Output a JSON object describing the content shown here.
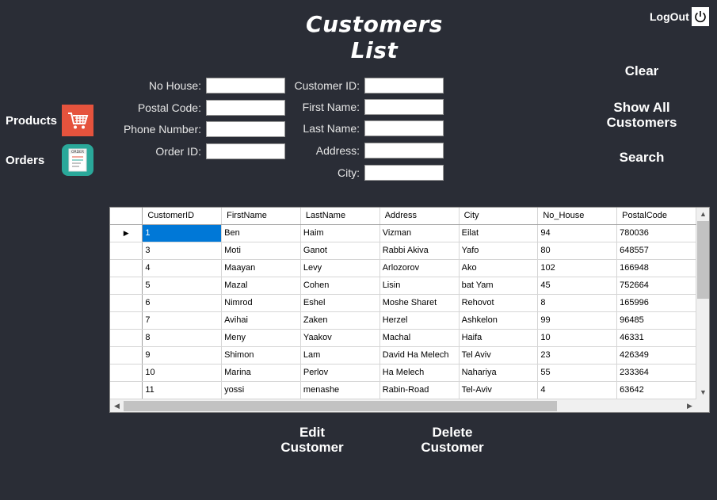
{
  "title": "Customers List",
  "logout": {
    "label": "LogOut"
  },
  "nav": {
    "products_label": "Products",
    "orders_label": "Orders",
    "orders_icon_text": "ORDER"
  },
  "form": {
    "no_house_label": "No House:",
    "postal_code_label": "Postal Code:",
    "phone_number_label": "Phone Number:",
    "order_id_label": "Order ID:",
    "customer_id_label": "Customer ID:",
    "first_name_label": "First Name:",
    "last_name_label": "Last Name:",
    "address_label": "Address:",
    "city_label": "City:",
    "no_house_value": "",
    "postal_code_value": "",
    "phone_number_value": "",
    "order_id_value": "",
    "customer_id_value": "",
    "first_name_value": "",
    "last_name_value": "",
    "address_value": "",
    "city_value": ""
  },
  "actions": {
    "clear": "Clear",
    "show_all_line1": "Show All",
    "show_all_line2": "Customers",
    "search": "Search",
    "edit_line1": "Edit",
    "edit_line2": "Customer",
    "delete_line1": "Delete",
    "delete_line2": "Customer"
  },
  "grid": {
    "columns": [
      "CustomerID",
      "FirstName",
      "LastName",
      "Address",
      "City",
      "No_House",
      "PostalCode"
    ],
    "rows": [
      [
        "1",
        "Ben",
        "Haim",
        "Vizman",
        "Eilat",
        "94",
        "780036"
      ],
      [
        "3",
        "Moti",
        "Ganot",
        "Rabbi Akiva",
        "Yafo",
        "80",
        "648557"
      ],
      [
        "4",
        "Maayan",
        "Levy",
        "Arlozorov",
        "Ako",
        "102",
        "166948"
      ],
      [
        "5",
        "Mazal",
        "Cohen",
        "Lisin",
        "bat Yam",
        "45",
        "752664"
      ],
      [
        "6",
        "Nimrod",
        "Eshel",
        "Moshe Sharet",
        "Rehovot",
        "8",
        "165996"
      ],
      [
        "7",
        "Avihai",
        "Zaken",
        "Herzel",
        "Ashkelon",
        "99",
        "96485"
      ],
      [
        "8",
        "Meny",
        "Yaakov",
        "Machal",
        "Haifa",
        "10",
        "46331"
      ],
      [
        "9",
        "Shimon",
        "Lam",
        "David Ha Melech",
        "Tel Aviv",
        "23",
        "426349"
      ],
      [
        "10",
        "Marina",
        "Perlov",
        "Ha Melech",
        "Nahariya",
        "55",
        "233364"
      ],
      [
        "11",
        "yossi",
        "menashe",
        "Rabin-Road",
        "Tel-Aviv",
        "4",
        "63642"
      ]
    ],
    "selected_row": 0
  }
}
